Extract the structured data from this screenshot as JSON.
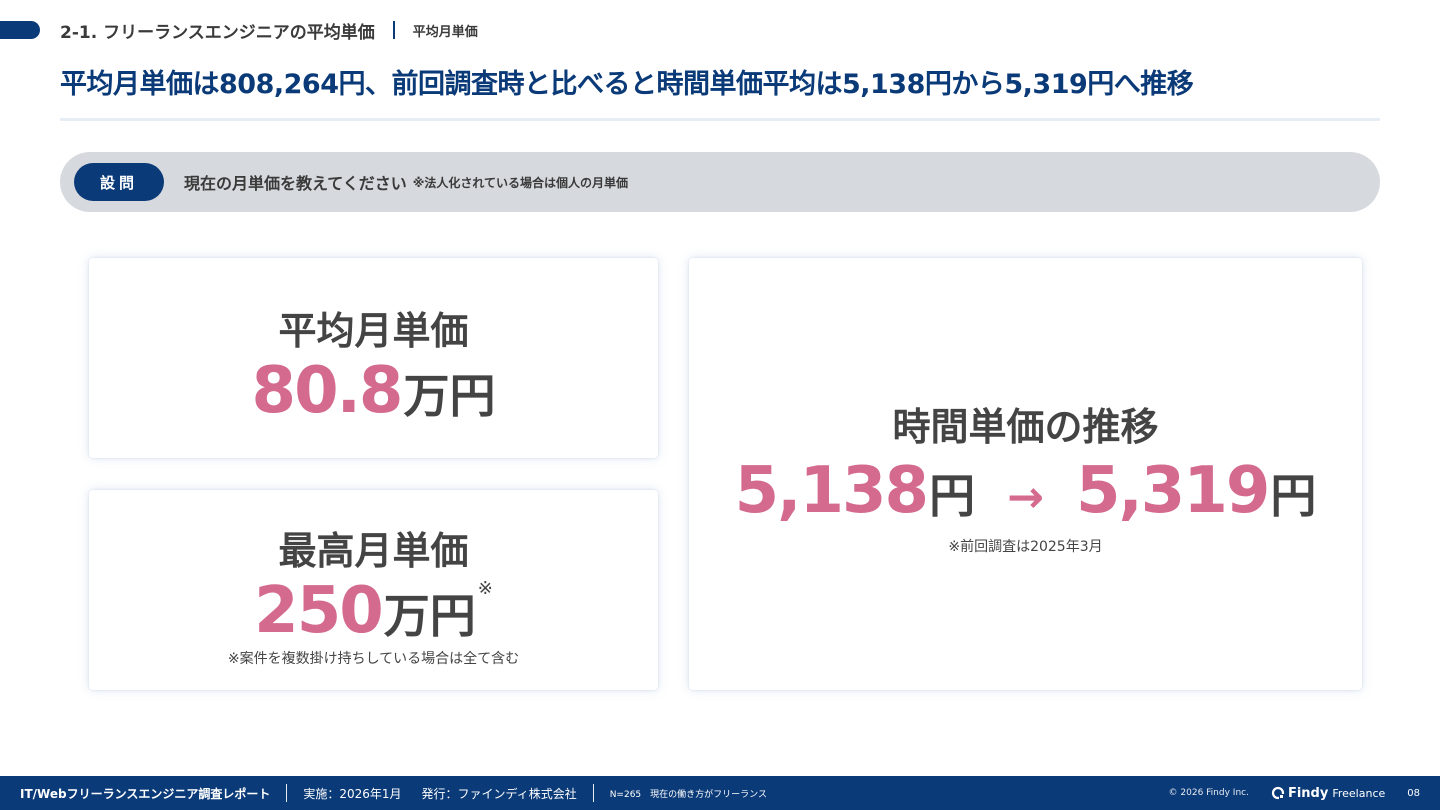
{
  "header": {
    "section_title": "2-1. フリーランスエンジニアの平均単価",
    "section_sub": "平均月単価",
    "headline": "平均月単価は808,264円、前回調査時と比べると時間単価平均は5,138円から5,319円へ推移"
  },
  "question": {
    "badge": "設問",
    "text": "現在の月単価を教えてください",
    "note": "※法人化されている場合は個人の月単価"
  },
  "cards": {
    "avg_monthly": {
      "label": "平均月単価",
      "value": "80.8",
      "unit": "万円"
    },
    "max_monthly": {
      "label": "最高月単価",
      "value": "250",
      "unit": "万円",
      "mark": "※",
      "note": "※案件を複数掛け持ちしている場合は全て含む"
    },
    "hourly": {
      "label": "時間単価の推移",
      "from_value": "5,138",
      "from_unit": "円",
      "arrow": "→",
      "to_value": "5,319",
      "to_unit": "円",
      "note": "※前回調査は2025年3月"
    }
  },
  "footer": {
    "title": "IT/Webフリーランスエンジニア調査レポート",
    "date": "実施：2026年1月",
    "publisher": "発行：ファインディ株式会社",
    "sample": "N=265　現在の働き方がフリーランス",
    "copyright": "© 2026 Findy Inc.",
    "brand": "Findy",
    "brand_sub": "Freelance",
    "page": "08"
  },
  "colors": {
    "navy": "#0b3a78",
    "pink": "#d46a8e",
    "question_bg": "#d6d9dd"
  }
}
